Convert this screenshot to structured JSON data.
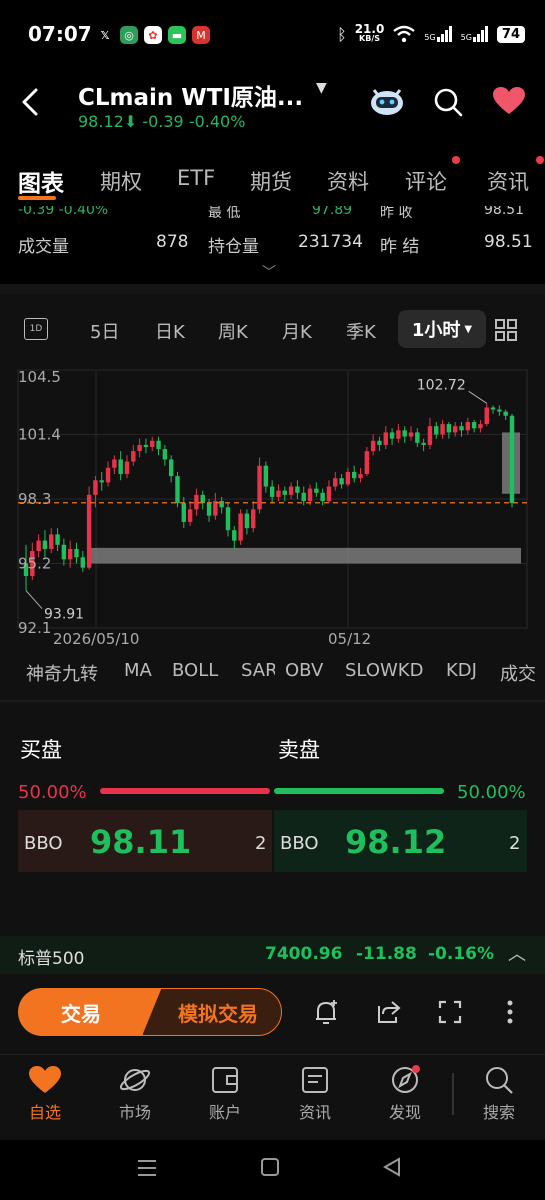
{
  "status_bar": {
    "time": "07:07",
    "net_speed_value": "21.0",
    "net_speed_unit": "KB/S",
    "signal1_label": "5G",
    "signal2_label": "5G",
    "battery": "74"
  },
  "header": {
    "title": "CLmain  WTI原油...",
    "price": "98.12",
    "change": "-0.39",
    "change_pct": "-0.40%"
  },
  "tabs": [
    {
      "label": "图表",
      "active": true
    },
    {
      "label": "期权"
    },
    {
      "label": "ETF"
    },
    {
      "label": "期货"
    },
    {
      "label": "资料"
    },
    {
      "label": "评论"
    },
    {
      "label": "资讯"
    }
  ],
  "stats": {
    "row0": {
      "change": "-0.39  -0.40%",
      "low_label": "最  低",
      "low": "97.89",
      "prev_close_label": "昨  收",
      "prev_close": "98.51"
    },
    "row1": {
      "volume_label": "成交量",
      "volume": "878",
      "oi_label": "持仓量",
      "oi": "231734",
      "settle_label": "昨  结",
      "settle": "98.51"
    }
  },
  "chart_toolbar": {
    "icon_1d": "1D",
    "items": [
      "5日",
      "日K",
      "周K",
      "月K",
      "季K"
    ],
    "active": "1小时"
  },
  "chart_data": {
    "type": "candlestick",
    "yticks": [
      "104.5",
      "101.4",
      "98.3",
      "95.2",
      "92.1"
    ],
    "ylim": [
      92.1,
      104.5
    ],
    "xticks": [
      "2026/05/10",
      "05/12"
    ],
    "current_price": 98.12,
    "high_annotation": "102.72",
    "low_annotation": "93.91",
    "candles": [
      [
        95.2,
        94.6,
        96.1,
        93.9
      ],
      [
        94.6,
        95.8,
        96.2,
        94.4
      ],
      [
        95.8,
        96.3,
        96.6,
        95.5
      ],
      [
        96.3,
        95.9,
        96.8,
        95.4
      ],
      [
        95.9,
        96.6,
        96.9,
        95.7
      ],
      [
        96.6,
        96.1,
        96.9,
        95.8
      ],
      [
        96.1,
        95.4,
        96.4,
        95.1
      ],
      [
        95.4,
        95.9,
        96.3,
        95.0
      ],
      [
        95.9,
        95.5,
        96.2,
        95.2
      ],
      [
        95.5,
        95.0,
        95.8,
        94.8
      ],
      [
        95.0,
        98.5,
        98.9,
        94.9
      ],
      [
        98.5,
        99.2,
        99.4,
        97.9
      ],
      [
        99.2,
        99.1,
        99.6,
        98.7
      ],
      [
        99.1,
        99.8,
        100.1,
        98.9
      ],
      [
        99.8,
        100.2,
        100.4,
        99.5
      ],
      [
        100.2,
        99.5,
        100.6,
        99.2
      ],
      [
        99.5,
        100.1,
        100.4,
        99.3
      ],
      [
        100.1,
        100.6,
        100.9,
        99.9
      ],
      [
        100.6,
        100.9,
        101.2,
        100.3
      ],
      [
        100.9,
        100.8,
        101.2,
        100.5
      ],
      [
        100.8,
        101.1,
        101.3,
        100.6
      ],
      [
        101.1,
        100.7,
        101.3,
        100.4
      ],
      [
        100.7,
        100.2,
        100.9,
        99.9
      ],
      [
        100.2,
        99.4,
        100.4,
        99.1
      ],
      [
        99.4,
        98.1,
        99.6,
        97.9
      ],
      [
        98.1,
        97.2,
        98.4,
        96.9
      ],
      [
        97.2,
        97.8,
        98.2,
        97.0
      ],
      [
        97.8,
        98.5,
        98.8,
        97.5
      ],
      [
        98.5,
        98.1,
        98.7,
        97.8
      ],
      [
        98.1,
        97.5,
        98.3,
        97.2
      ],
      [
        97.5,
        98.2,
        98.6,
        97.3
      ],
      [
        98.2,
        97.9,
        98.4,
        97.6
      ],
      [
        97.9,
        96.8,
        98.1,
        96.5
      ],
      [
        96.8,
        96.3,
        97.0,
        95.9
      ],
      [
        96.3,
        97.6,
        97.8,
        96.1
      ],
      [
        97.6,
        96.9,
        97.8,
        96.6
      ],
      [
        96.9,
        97.8,
        98.2,
        96.7
      ],
      [
        97.8,
        99.9,
        100.3,
        97.6
      ],
      [
        99.9,
        98.9,
        100.1,
        98.6
      ],
      [
        98.9,
        98.4,
        99.2,
        98.1
      ],
      [
        98.4,
        98.7,
        99.0,
        98.2
      ],
      [
        98.7,
        98.5,
        98.9,
        98.2
      ],
      [
        98.5,
        98.9,
        99.1,
        98.3
      ],
      [
        98.9,
        98.6,
        99.2,
        98.3
      ],
      [
        98.6,
        98.2,
        98.9,
        98.0
      ],
      [
        98.2,
        98.8,
        99.0,
        98.0
      ],
      [
        98.8,
        98.6,
        99.1,
        98.4
      ],
      [
        98.6,
        98.2,
        98.8,
        98.0
      ],
      [
        98.2,
        98.9,
        99.2,
        98.1
      ],
      [
        98.9,
        99.3,
        99.6,
        98.7
      ],
      [
        99.3,
        99.0,
        99.5,
        98.8
      ],
      [
        99.0,
        99.6,
        99.8,
        98.9
      ],
      [
        99.6,
        99.3,
        99.9,
        99.1
      ],
      [
        99.3,
        99.5,
        99.8,
        99.1
      ],
      [
        99.5,
        100.6,
        100.8,
        99.4
      ],
      [
        100.6,
        101.1,
        101.4,
        100.4
      ],
      [
        101.1,
        100.9,
        101.3,
        100.6
      ],
      [
        100.9,
        101.5,
        101.8,
        100.7
      ],
      [
        101.5,
        101.2,
        101.7,
        100.9
      ],
      [
        101.2,
        101.6,
        101.9,
        101.0
      ],
      [
        101.6,
        101.3,
        101.8,
        101.0
      ],
      [
        101.3,
        101.5,
        101.8,
        101.1
      ],
      [
        101.5,
        101.0,
        101.7,
        100.8
      ],
      [
        101.0,
        100.9,
        101.2,
        100.6
      ],
      [
        100.9,
        101.8,
        102.2,
        100.7
      ],
      [
        101.8,
        101.4,
        102.0,
        101.2
      ],
      [
        101.4,
        101.9,
        102.1,
        101.2
      ],
      [
        101.9,
        101.5,
        102.0,
        101.2
      ],
      [
        101.5,
        101.8,
        102.0,
        101.3
      ],
      [
        101.8,
        101.6,
        102.0,
        101.3
      ],
      [
        101.6,
        102.0,
        102.2,
        101.4
      ],
      [
        102.0,
        101.7,
        102.1,
        101.5
      ],
      [
        101.7,
        101.9,
        102.1,
        101.5
      ],
      [
        101.9,
        102.7,
        102.9,
        101.8
      ],
      [
        102.7,
        102.6,
        102.8,
        102.4
      ],
      [
        102.6,
        102.5,
        102.8,
        102.3
      ],
      [
        102.5,
        102.3,
        102.6,
        102.1
      ],
      [
        102.3,
        98.1,
        102.4,
        97.9
      ]
    ],
    "gap_zones": [
      {
        "y_top": 95.95,
        "y_bottom": 95.2,
        "label": ""
      },
      {
        "y_top": 101.5,
        "y_bottom": 98.55,
        "label": ""
      }
    ]
  },
  "indicators": [
    "神奇九转",
    "MA",
    "BOLL",
    "SAR",
    "OBV",
    "SLOWKD",
    "KDJ",
    "成交"
  ],
  "order_book": {
    "buy_title": "买盘",
    "sell_title": "卖盘",
    "buy_pct": "50.00%",
    "sell_pct": "50.00%",
    "buy_label": "BBO",
    "buy_price": "98.11",
    "buy_qty": "2",
    "sell_label": "BBO",
    "sell_price": "98.12",
    "sell_qty": "2"
  },
  "index_bar": {
    "name": "标普500",
    "value": "7400.96",
    "change": "-11.88",
    "change_pct": "-0.16%"
  },
  "trade_bar": {
    "trade_label": "交易",
    "sim_label": "模拟交易"
  },
  "bottom_nav": [
    {
      "label": "自选",
      "icon": "heart-icon",
      "active": true
    },
    {
      "label": "市场",
      "icon": "planet-icon"
    },
    {
      "label": "账户",
      "icon": "wallet-icon"
    },
    {
      "label": "资讯",
      "icon": "news-icon"
    },
    {
      "label": "发现",
      "icon": "compass-icon"
    },
    {
      "label": "搜索",
      "icon": "search-icon"
    }
  ],
  "colors": {
    "up": "#e8334a",
    "down": "#1fbf5e",
    "accent": "#f27420",
    "price_line": "#f27420"
  }
}
